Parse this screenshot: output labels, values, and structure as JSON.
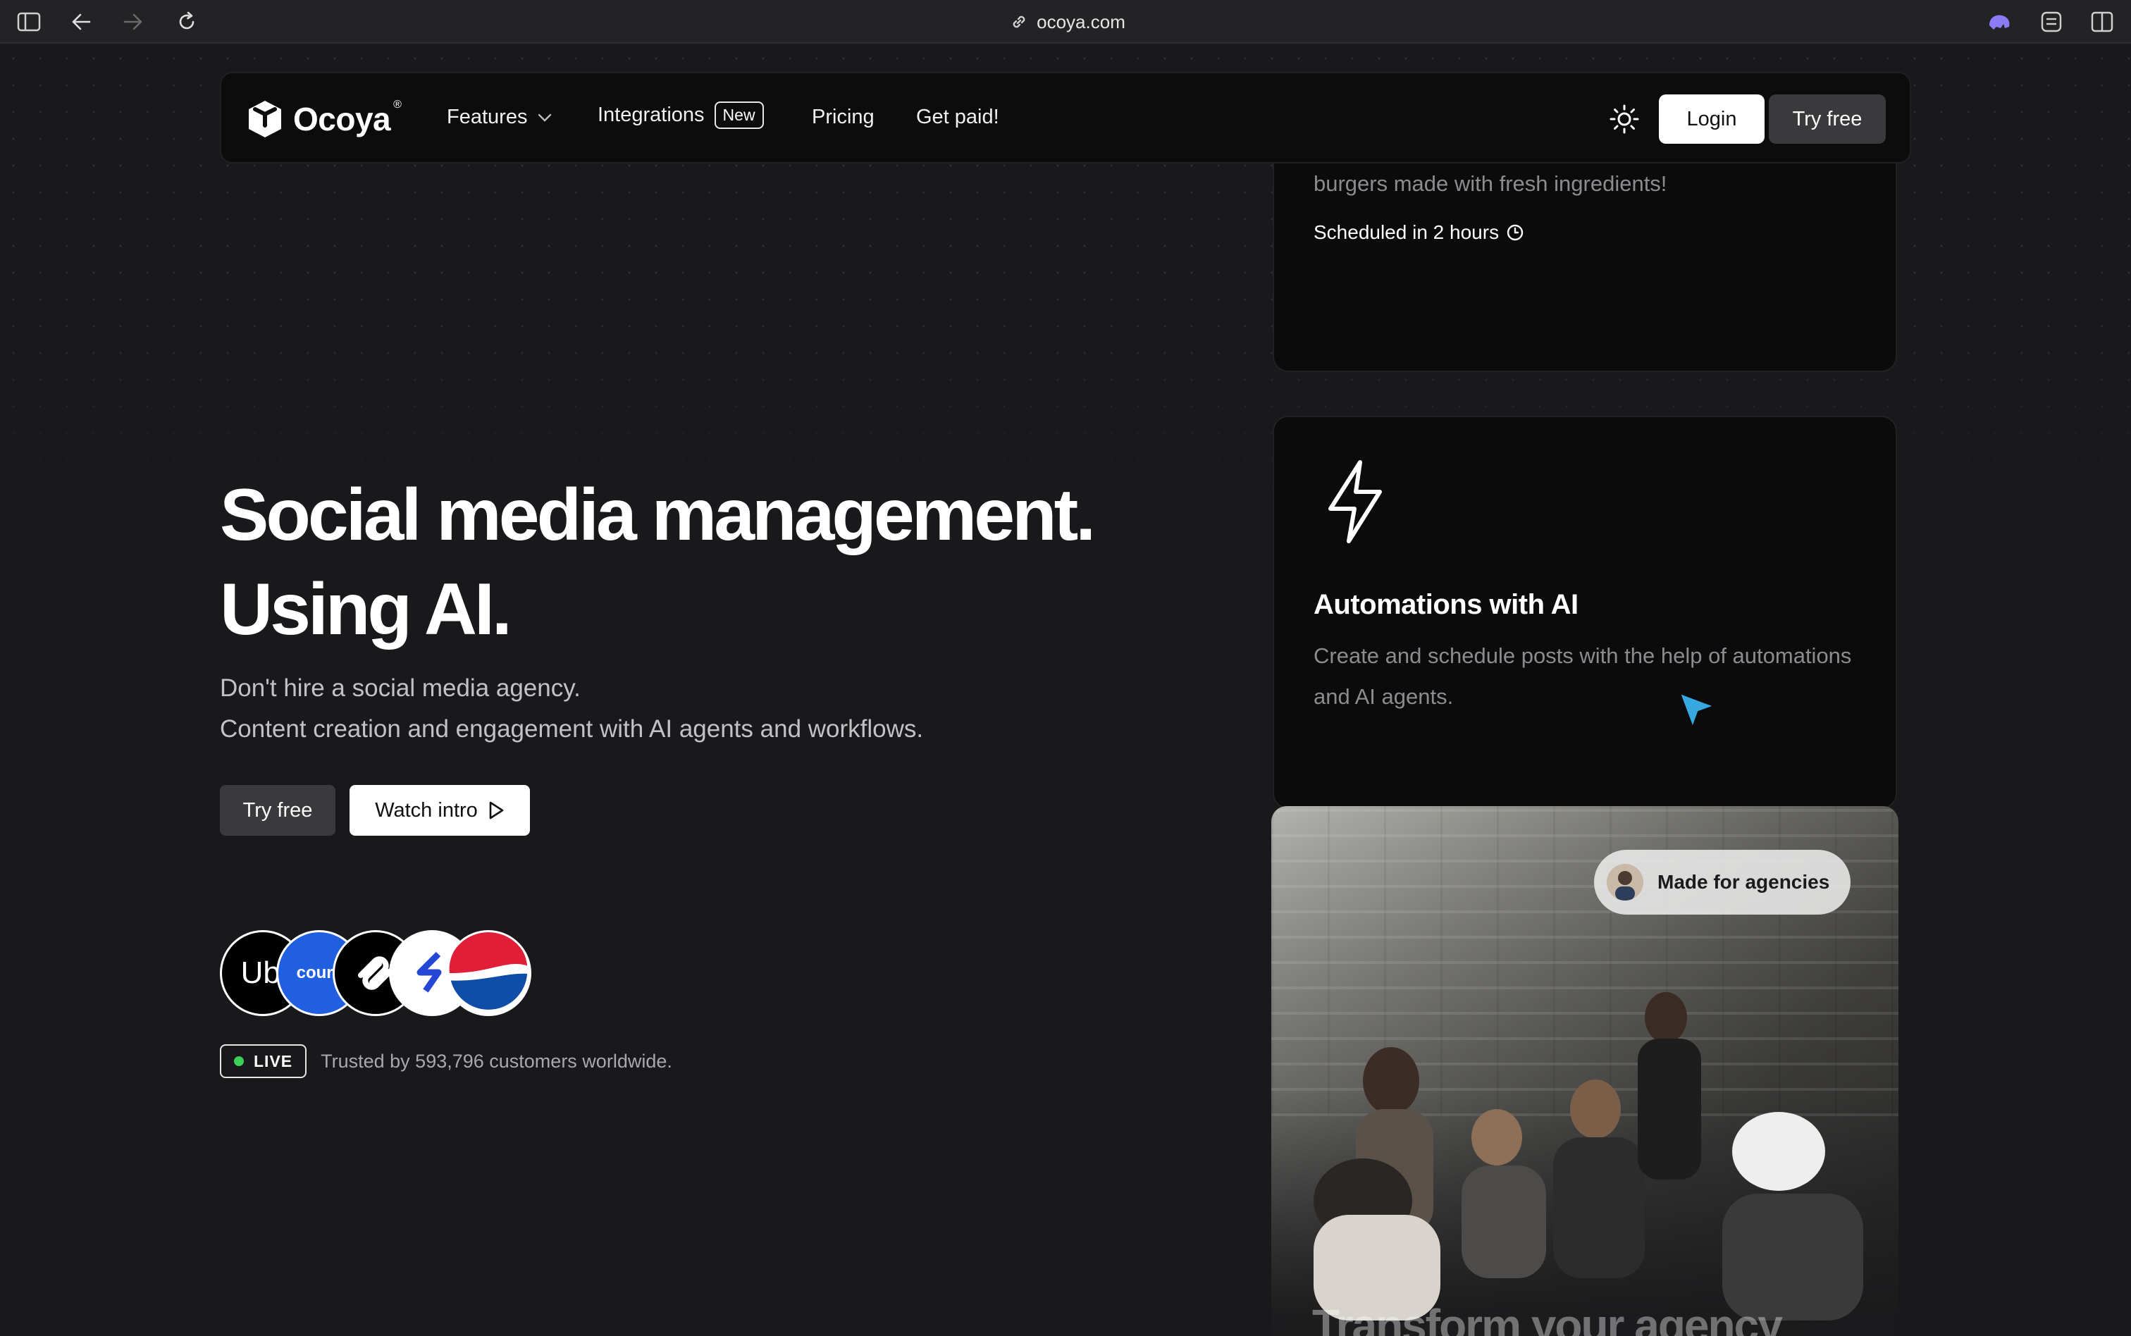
{
  "browser": {
    "url": "ocoya.com"
  },
  "nav": {
    "brand": "Ocoya",
    "brand_mark": "®",
    "features": "Features",
    "integrations": "Integrations",
    "integrations_badge": "New",
    "pricing": "Pricing",
    "get_paid": "Get paid!",
    "login": "Login",
    "try_free": "Try free"
  },
  "hero": {
    "title_line1": "Social media management.",
    "title_line2": "Using AI.",
    "sub_line1": "Don't hire a social media agency.",
    "sub_line2": "Content creation and engagement with AI agents and workflows.",
    "try_free": "Try free",
    "watch_intro": "Watch intro",
    "brands": [
      "Ube",
      "course"
    ],
    "live": "LIVE",
    "trusted": "Trusted by 593,796 customers worldwide."
  },
  "cards": {
    "post_text": "Tired of eating the same old burger? Try our new burgers made with fresh ingredients!",
    "scheduled": "Scheduled in 2 hours",
    "automations_title": "Automations with AI",
    "automations_text": "Create and schedule posts with the help of automations and AI agents.",
    "agencies_pill": "Made for agencies",
    "agencies_heading": "Transform your agency"
  },
  "colors": {
    "page_bg": "#19191b",
    "card_bg": "#0b0b0c",
    "live_dot": "#3ccf5a",
    "cursor": "#38a8e0"
  }
}
